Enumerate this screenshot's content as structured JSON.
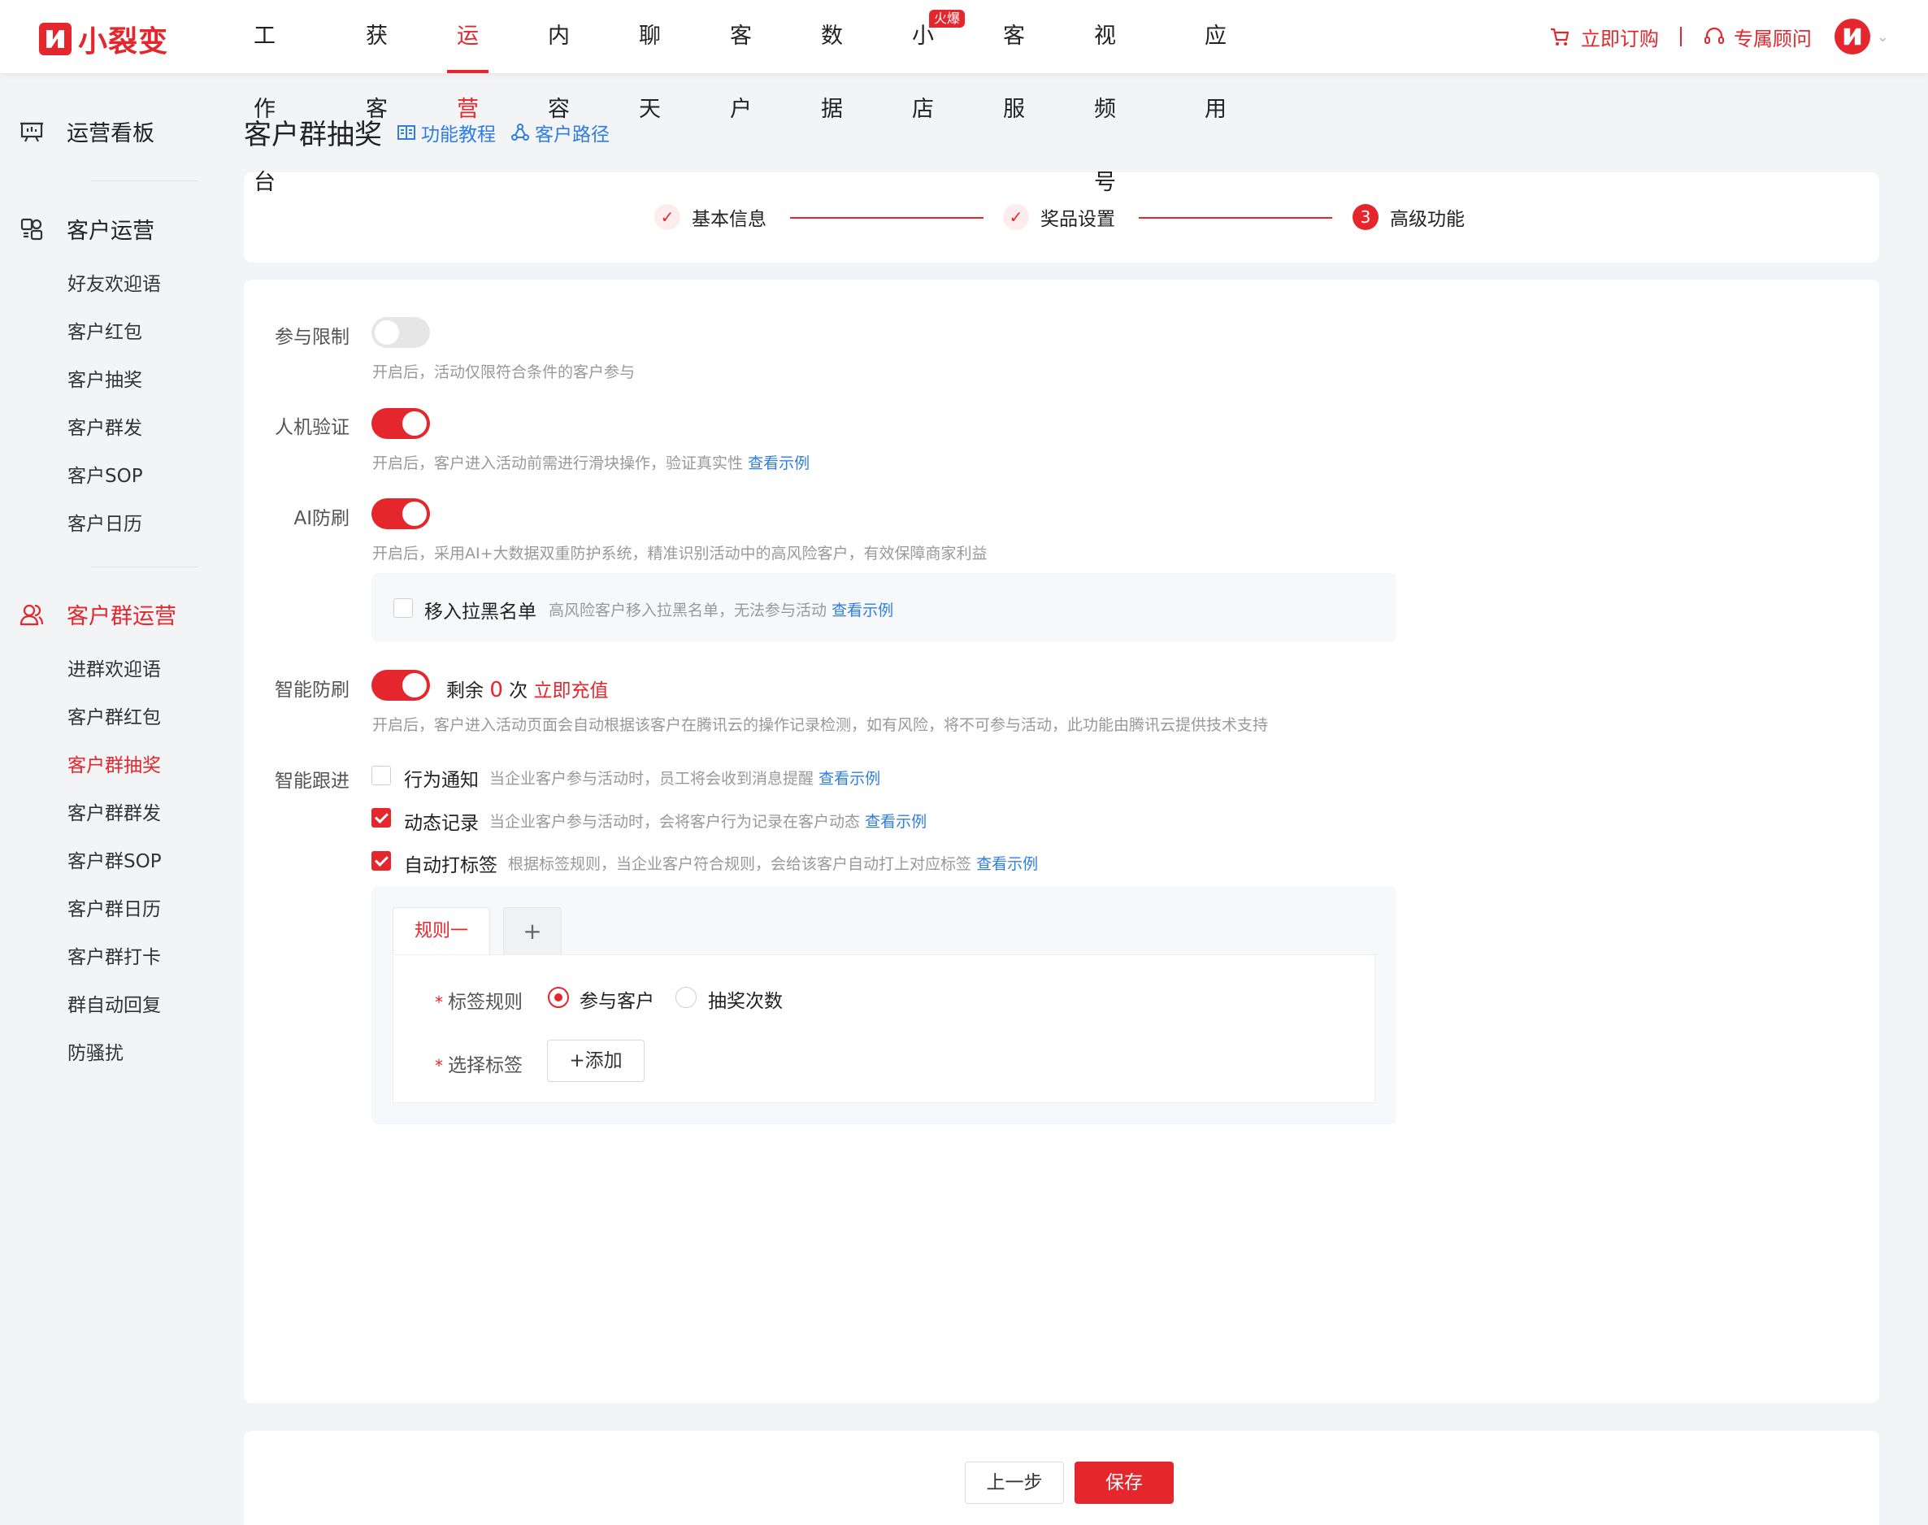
{
  "brand": {
    "name": "小裂变",
    "color": "#e5262d"
  },
  "nav": {
    "items": [
      {
        "label": "工作台"
      },
      {
        "label": "获客"
      },
      {
        "label": "运营"
      },
      {
        "label": "内容"
      },
      {
        "label": "聊天"
      },
      {
        "label": "客户"
      },
      {
        "label": "数据"
      },
      {
        "label": "小店",
        "badge": "火爆"
      },
      {
        "label": "客服"
      },
      {
        "label": "视频号"
      },
      {
        "label": "应用"
      }
    ],
    "active": "运营",
    "subscribe": "立即订购",
    "consultant": "专属顾问"
  },
  "sidebar": {
    "groups": [
      {
        "title": "运营看板",
        "icon": "dashboard-icon",
        "items": []
      },
      {
        "title": "客户运营",
        "icon": "customer-ops-icon",
        "items": [
          "好友欢迎语",
          "客户红包",
          "客户抽奖",
          "客户群发",
          "客户SOP",
          "客户日历"
        ]
      },
      {
        "title": "客户群运营",
        "icon": "group-ops-icon",
        "items": [
          "进群欢迎语",
          "客户群红包",
          "客户群抽奖",
          "客户群群发",
          "客户群SOP",
          "客户群日历",
          "客户群打卡",
          "群自动回复",
          "防骚扰"
        ]
      }
    ],
    "active_item": "客户群抽奖"
  },
  "page": {
    "title": "客户群抽奖",
    "tutorial_link": "功能教程",
    "path_link": "客户路径"
  },
  "steps": [
    {
      "label": "基本信息",
      "status": "done"
    },
    {
      "label": "奖品设置",
      "status": "done"
    },
    {
      "label": "高级功能",
      "status": "current",
      "number": "3"
    }
  ],
  "settings": {
    "participation": {
      "label": "参与限制",
      "enabled": false,
      "desc": "开启后，活动仅限符合条件的客户参与"
    },
    "captcha": {
      "label": "人机验证",
      "enabled": true,
      "desc": "开启后，客户进入活动前需进行滑块操作，验证真实性",
      "link": "查看示例"
    },
    "ai_antifraud": {
      "label": "AI防刷",
      "enabled": true,
      "desc": "开启后，采用AI+大数据双重防护系统，精准识别活动中的高风险客户，有效保障商家利益",
      "blacklist": {
        "label": "移入拉黑名单",
        "checked": false,
        "desc": "高风险客户移入拉黑名单，无法参与活动",
        "link": "查看示例"
      }
    },
    "smart_antifraud": {
      "label": "智能防刷",
      "enabled": true,
      "remaining_prefix": "剩余",
      "remaining_count": "0",
      "remaining_suffix": "次",
      "recharge": "立即充值",
      "desc": "开启后，客户进入活动页面会自动根据该客户在腾讯云的操作记录检测，如有风险，将不可参与活动，此功能由腾讯云提供技术支持"
    },
    "smart_follow": {
      "label": "智能跟进",
      "options": [
        {
          "label": "行为通知",
          "checked": false,
          "desc": "当企业客户参与活动时，员工将会收到消息提醒",
          "link": "查看示例"
        },
        {
          "label": "动态记录",
          "checked": true,
          "desc": "当企业客户参与活动时，会将客户行为记录在客户动态",
          "link": "查看示例"
        },
        {
          "label": "自动打标签",
          "checked": true,
          "desc": "根据标签规则，当企业客户符合规则，会给该客户自动打上对应标签",
          "link": "查看示例"
        }
      ]
    }
  },
  "rules": {
    "tabs": [
      "规则一"
    ],
    "add_tab": "+",
    "tag_rule_label": "标签规则",
    "tag_rule_options": [
      {
        "label": "参与客户",
        "selected": true
      },
      {
        "label": "抽奖次数",
        "selected": false
      }
    ],
    "select_tag_label": "选择标签",
    "add_button": "+添加",
    "required_mark": "*"
  },
  "footer": {
    "prev": "上一步",
    "save": "保存"
  }
}
